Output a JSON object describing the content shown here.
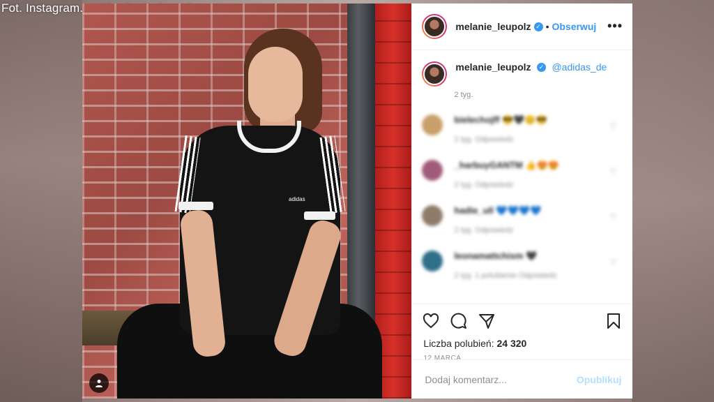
{
  "credit": "Fot. Instagram.com/melanie_leupolz",
  "post": {
    "username": "melanie_leupolz",
    "follow_label": "Obserwuj",
    "more_label": "•••",
    "caption_mention": "@adidas_de",
    "caption_time": "2 tyg.",
    "comments": [
      {
        "author": "bielechojff",
        "text": "😎🖤😊😎",
        "meta": "2 tyg.   Odpowiedz",
        "avatar_color": "#c8a06a"
      },
      {
        "author": "_harbuyGANTM",
        "text": "👍😍😍",
        "meta": "2 tyg.   Odpowiedz",
        "avatar_color": "#a05b7a"
      },
      {
        "author": "hadie_ull",
        "text": "💙💙💙💙",
        "meta": "2 tyg.   Odpowiedz",
        "avatar_color": "#8f7b6a"
      },
      {
        "author": "leonamattchism",
        "text": "🖤",
        "meta": "2 tyg.   1 polubienie   Odpowiedz",
        "avatar_color": "#2f6f8a"
      }
    ],
    "likes_label": "Liczba polubień:",
    "likes_count": "24 320",
    "date": "12 MARCA",
    "comment_placeholder": "Dodaj komentarz...",
    "publish_label": "Opublikuj",
    "brand_text": "adidas"
  },
  "icons": {
    "like": "heart-icon",
    "comment": "comment-icon",
    "share": "paper-plane-icon",
    "save": "bookmark-icon",
    "verified": "verified-badge-icon",
    "tag": "user-tag-icon"
  },
  "colors": {
    "accent": "#3897f0",
    "muted": "#8e8e8e",
    "text": "#262626",
    "publish_disabled": "#b2dffc"
  }
}
